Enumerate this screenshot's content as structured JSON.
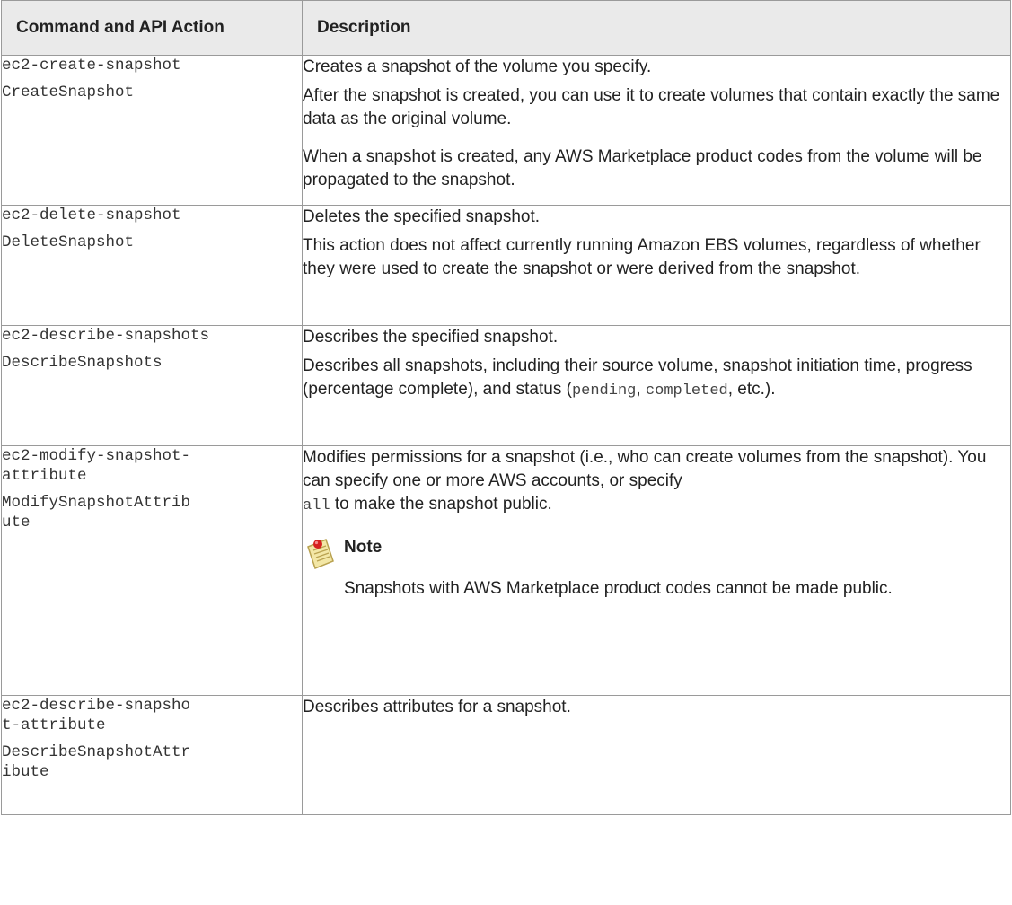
{
  "header": {
    "col1": "Command and API Action",
    "col2": "Description"
  },
  "rows": [
    {
      "cli": "ec2-create-snapshot",
      "api": "CreateSnapshot",
      "desc1": "Creates a snapshot of the volume you specify.",
      "desc2": "After the snapshot is created, you can use it to create volumes that contain exactly the same data as the original volume.",
      "desc3": "When a snapshot is created, any AWS Marketplace product codes from the volume will be propagated to the snapshot."
    },
    {
      "cli": "ec2-delete-snapshot",
      "api": "DeleteSnapshot",
      "desc1": "Deletes the specified snapshot.",
      "desc2": "This action does not affect currently running Amazon EBS volumes, regardless of whether they were used to create the snapshot or were derived from the snapshot."
    },
    {
      "cli": "ec2-describe-snapshots",
      "api": "DescribeSnapshots",
      "desc1": "Describes the specified snapshot.",
      "desc2_pre": "Describes all snapshots, including their source volume, snapshot initiation time, progress (percentage complete), and status (",
      "code1": "pending",
      "sep": ", ",
      "code2": "completed",
      "desc2_post": ", etc.)."
    },
    {
      "cli_line1": "ec2-modify-snapshot-",
      "cli_line2": "attribute",
      "api_line1": "ModifySnapshotAttrib",
      "api_line2": "ute",
      "desc1": "Modifies permissions for a snapshot (i.e., who can create volumes from the snapshot). You can specify one or more AWS accounts, or specify",
      "code": "all",
      "desc1_post": " to make the snapshot public.",
      "note_title": "Note",
      "note_body": "Snapshots with AWS Marketplace product codes cannot be made public."
    },
    {
      "cli_line1": "ec2-describe-snapsho",
      "cli_line2": "t-attribute",
      "api_line1": "DescribeSnapshotAttr",
      "api_line2": "ibute",
      "desc1": "Describes attributes for a snapshot."
    }
  ],
  "icons": {
    "note": "note-pushpin-icon"
  }
}
